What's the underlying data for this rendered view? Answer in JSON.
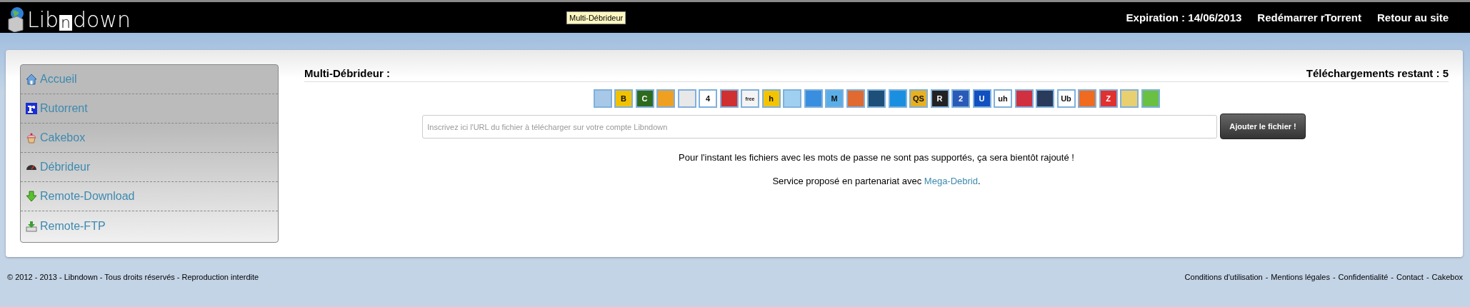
{
  "header": {
    "logo": {
      "before": "Lib",
      "boxed": "n",
      "after": "down"
    },
    "tooltip": "Multi-Débrideur",
    "expiration": "Expiration : 14/06/2013",
    "links": [
      "Redémarrer rTorrent",
      "Retour au site"
    ]
  },
  "sidebar": {
    "items": [
      {
        "label": "Accueil",
        "kind": "house"
      },
      {
        "label": "Rutorrent",
        "kind": "rutorrent"
      },
      {
        "label": "Cakebox",
        "kind": "cake"
      },
      {
        "label": "Débrideur",
        "kind": "gauge"
      },
      {
        "label": "Remote-Download",
        "kind": "download"
      },
      {
        "label": "Remote-FTP",
        "kind": "tray"
      }
    ]
  },
  "main": {
    "title": "Multi-Débrideur :",
    "remaining": "Téléchargements restant : 5",
    "hosters": [
      {
        "color": "#a8c8e8"
      },
      {
        "color": "#f2c200",
        "glyph": "B"
      },
      {
        "color": "#2e6b1e",
        "glyph": "C"
      },
      {
        "color": "#f0a020"
      },
      {
        "color": "#e8e8e8"
      },
      {
        "color": "#ffffff",
        "glyph": "4"
      },
      {
        "color": "#d03030"
      },
      {
        "color": "#f4f4f4",
        "glyph": "free"
      },
      {
        "color": "#f5c400",
        "glyph": "h"
      },
      {
        "color": "#9fd0f0"
      },
      {
        "color": "#3a8ee0"
      },
      {
        "color": "#5aaee8",
        "glyph": "M"
      },
      {
        "color": "#e06a30"
      },
      {
        "color": "#1e4f78"
      },
      {
        "color": "#1a8fe0"
      },
      {
        "color": "#e8b020",
        "glyph": "QS"
      },
      {
        "color": "#222222",
        "glyph": "R"
      },
      {
        "color": "#2a5ab8",
        "glyph": "2"
      },
      {
        "color": "#1050c0",
        "glyph": "U"
      },
      {
        "color": "#ffffff",
        "glyph": "uh"
      },
      {
        "color": "#d03040"
      },
      {
        "color": "#2a3a5a"
      },
      {
        "color": "#ffffff",
        "glyph": "Ub"
      },
      {
        "color": "#f06a20"
      },
      {
        "color": "#e03030",
        "glyph": "Z"
      },
      {
        "color": "#e8d070"
      },
      {
        "color": "#6ac040"
      }
    ],
    "url_field": {
      "placeholder": "Inscrivez ici l'URL du fichier à télécharger sur votre compte Libndown"
    },
    "submit": "Ajouter le fichier !",
    "notice": "Pour l'instant les fichiers avec les mots de passe ne sont pas supportés, ça sera bientôt rajouté !",
    "partner": {
      "before": "Service proposé en partenariat avec ",
      "link": "Mega-Debrid",
      "after": "."
    }
  },
  "footer": {
    "copyright": "© 2012 - 2013 - Libndown - Tous droits réservés - Reproduction interdite",
    "separator": "-",
    "links": [
      "Conditions d'utilisation",
      "Mentions légales",
      "Confidentialité",
      "Contact",
      "Cakebox"
    ]
  }
}
